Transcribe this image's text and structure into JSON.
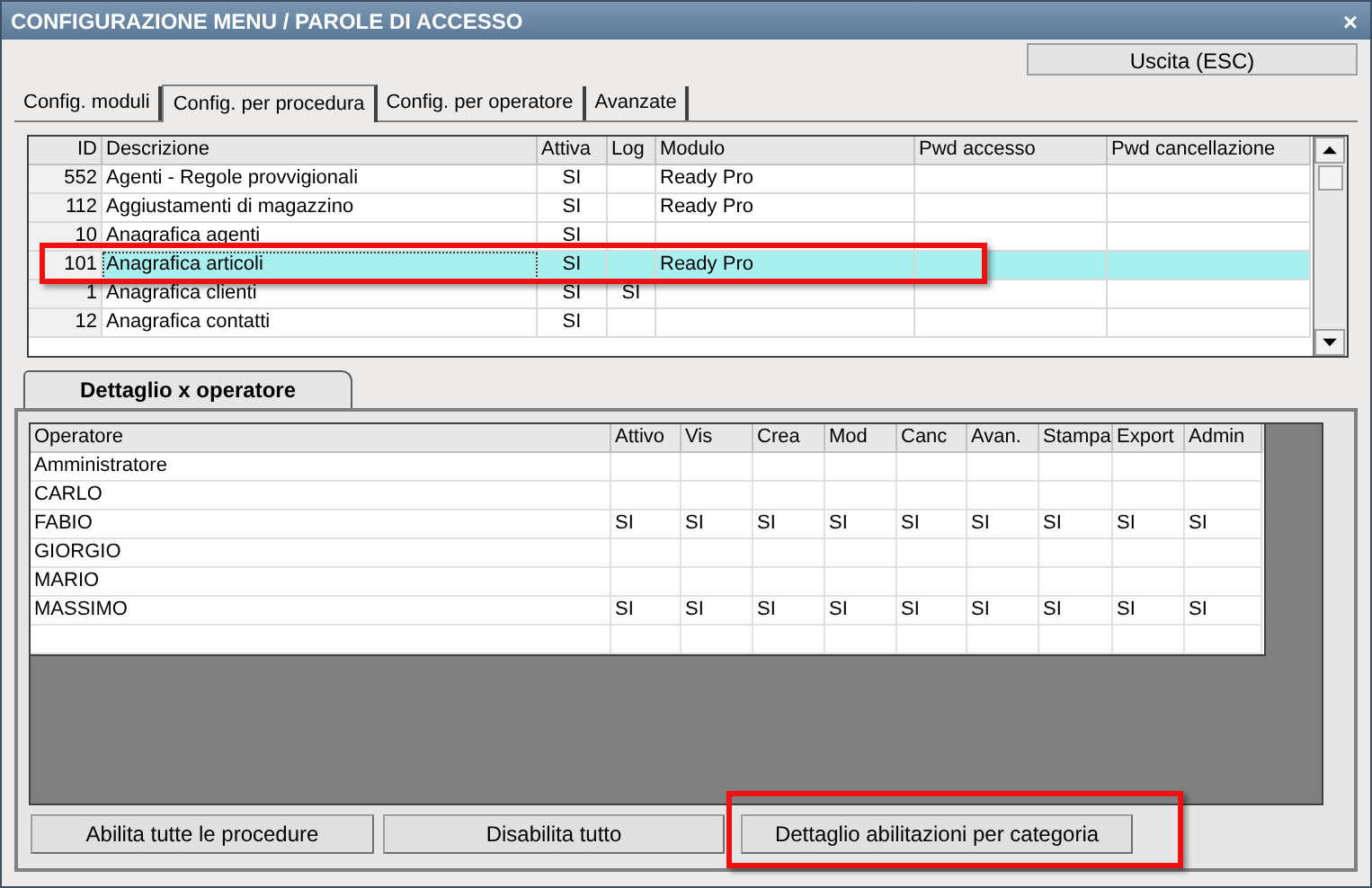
{
  "window": {
    "title": "CONFIGURAZIONE MENU / PAROLE DI ACCESSO",
    "close": "×"
  },
  "exit_button": "Uscita (ESC)",
  "tabs": [
    {
      "label": "Config. moduli",
      "selected": false
    },
    {
      "label": "Config. per procedura",
      "selected": true
    },
    {
      "label": "Config. per operatore",
      "selected": false
    },
    {
      "label": "Avanzate",
      "selected": false
    }
  ],
  "procedures": {
    "columns": [
      "ID",
      "Descrizione",
      "Attiva",
      "Log",
      "Modulo",
      "Pwd accesso",
      "Pwd cancellazione"
    ],
    "rows": [
      {
        "cells": [
          "552",
          "Agenti - Regole provvigionali",
          "SI",
          "",
          "Ready Pro",
          "",
          ""
        ],
        "selected": false
      },
      {
        "cells": [
          "112",
          "Aggiustamenti di magazzino",
          "SI",
          "",
          "Ready Pro",
          "",
          ""
        ],
        "selected": false
      },
      {
        "cells": [
          "10",
          "Anagrafica agenti",
          "SI",
          "",
          "",
          "",
          ""
        ],
        "selected": false
      },
      {
        "cells": [
          "101",
          "Anagrafica articoli",
          "SI",
          "",
          "Ready Pro",
          "",
          ""
        ],
        "selected": true
      },
      {
        "cells": [
          "1",
          "Anagrafica clienti",
          "SI",
          "SI",
          "",
          "",
          ""
        ],
        "selected": false
      },
      {
        "cells": [
          "12",
          "Anagrafica contatti",
          "SI",
          "",
          "",
          "",
          ""
        ],
        "selected": false
      }
    ]
  },
  "detail_tab": {
    "label": "Dettaglio x operatore",
    "selected": true
  },
  "operators": {
    "columns": [
      "Operatore",
      "Attivo",
      "Vis",
      "Crea",
      "Mod",
      "Canc",
      "Avan.",
      "Stampa",
      "Export",
      "Admin"
    ],
    "rows": [
      [
        "Amministratore",
        "",
        "",
        "",
        "",
        "",
        "",
        "",
        "",
        ""
      ],
      [
        "CARLO",
        "",
        "",
        "",
        "",
        "",
        "",
        "",
        "",
        ""
      ],
      [
        "FABIO",
        "SI",
        "SI",
        "SI",
        "SI",
        "SI",
        "SI",
        "SI",
        "SI",
        "SI"
      ],
      [
        "GIORGIO",
        "",
        "",
        "",
        "",
        "",
        "",
        "",
        "",
        ""
      ],
      [
        "MARIO",
        "",
        "",
        "",
        "",
        "",
        "",
        "",
        "",
        ""
      ],
      [
        "MASSIMO",
        "SI",
        "SI",
        "SI",
        "SI",
        "SI",
        "SI",
        "SI",
        "SI",
        "SI"
      ]
    ]
  },
  "buttons": [
    "Abilita tutte le procedure",
    "Disabilita tutto",
    "Dettaglio abilitazioni per categoria"
  ]
}
